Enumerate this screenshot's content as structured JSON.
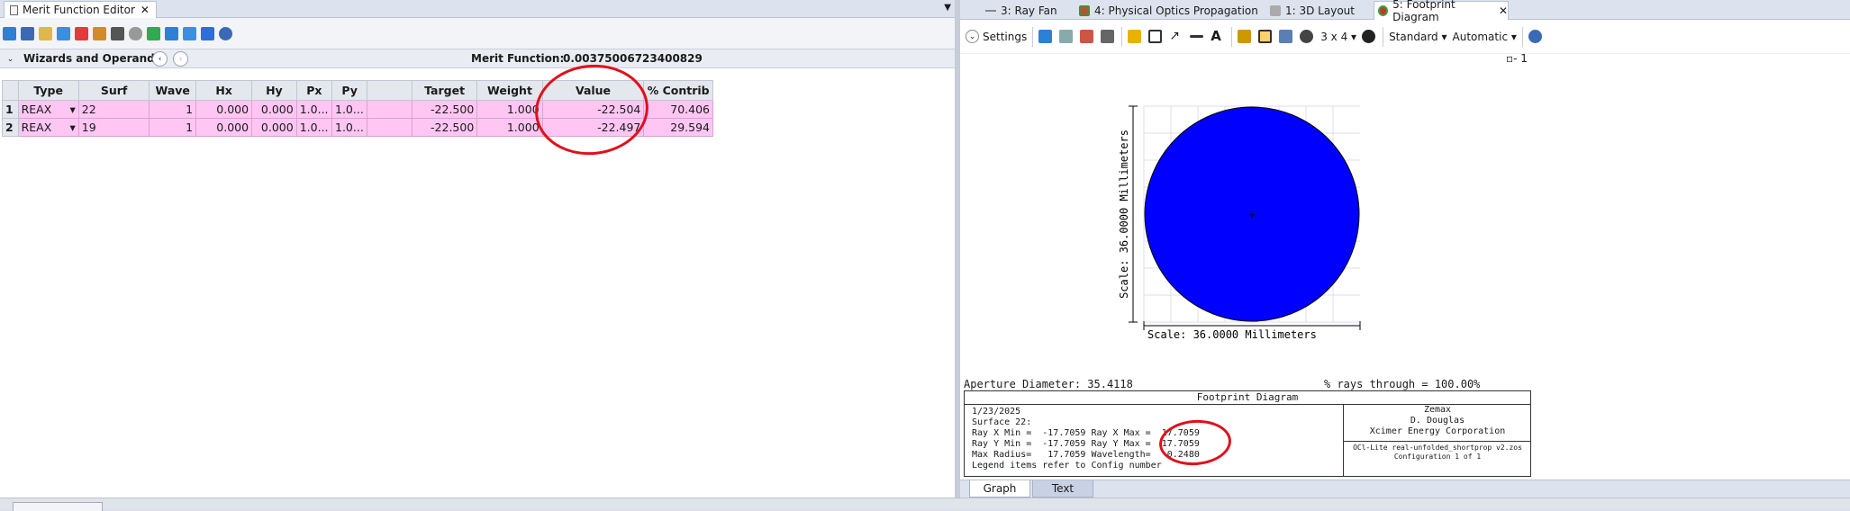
{
  "left_pane": {
    "tab_title": "Merit Function Editor",
    "wizards_label": "Wizards and Operands",
    "merit_label": "Merit Function:",
    "merit_value": "0.00375006723400829",
    "columns": [
      "",
      "Type",
      "Surf",
      "Wave",
      "Hx",
      "Hy",
      "Px",
      "Py",
      "",
      "Target",
      "Weight",
      "Value",
      "% Contrib"
    ],
    "rows": [
      [
        "1",
        "REAX",
        "22",
        "1",
        "0.000",
        "0.000",
        "1.0...",
        "1.0...",
        "",
        "-22.500",
        "1.000",
        "-22.504",
        "70.406"
      ],
      [
        "2",
        "REAX",
        "19",
        "1",
        "0.000",
        "0.000",
        "1.0...",
        "1.0...",
        "",
        "-22.500",
        "1.000",
        "-22.497",
        "29.594"
      ]
    ]
  },
  "right_pane": {
    "tabs": [
      {
        "label": "3: Ray Fan",
        "icon": "ray-fan-icon"
      },
      {
        "label": "4: Physical Optics Propagation",
        "icon": "pop-icon"
      },
      {
        "label": "1: 3D Layout",
        "icon": "layout-icon"
      },
      {
        "label": "5: Footprint Diagram",
        "icon": "footprint-icon",
        "active": true
      }
    ],
    "toolbar": {
      "settings": "Settings",
      "grid": "3 x 4",
      "standard": "Standard",
      "automatic": "Automatic"
    },
    "legend": "1",
    "plot": {
      "scale_vertical": "Scale: 36.0000 Millimeters",
      "scale_horizontal": "Scale: 36.0000 Millimeters",
      "footprint_color": "#0000ff"
    },
    "aperture_line": "Aperture Diameter: 35.4118",
    "rays_line": "% rays through = 100.00%",
    "info": {
      "title": "Footprint Diagram",
      "lines": [
        "1/23/2025",
        "Surface 22:",
        "Ray X Min =  -17.7059 Ray X Max =  17.7059",
        "Ray Y Min =  -17.7059 Ray Y Max =  17.7059",
        "Max Radius=   17.7059 Wavelength=   0.2480",
        "Legend items refer to Config number"
      ],
      "company": [
        "Zemax",
        "D. Douglas",
        "Xcimer Energy Corporation"
      ],
      "file": "OCl-Lite real-unfolded_shortprop v2.zos",
      "config": "Configuration 1 of 1"
    },
    "bottom_tabs": [
      "Graph",
      "Text"
    ]
  },
  "colors": {
    "row_pink": "#ffc6f3",
    "annotation_red": "#e0101a",
    "accent": "#1e6fd8"
  }
}
